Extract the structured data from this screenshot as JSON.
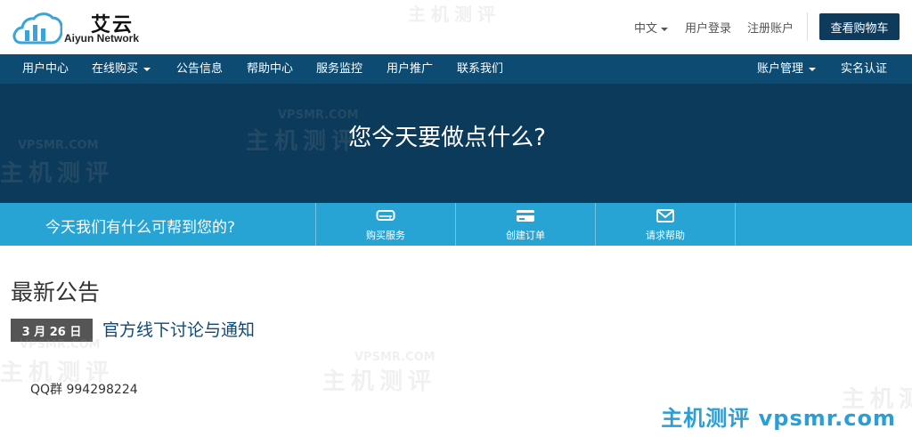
{
  "brand": {
    "name_cn": "艾云",
    "name_en": "Aiyun Network",
    "color_primary": "#0e3a5c",
    "color_nav": "#0d4b73",
    "color_hero": "#0b3a5a",
    "color_help": "#27a4d3",
    "logo_icon": "cloud-bars-logo"
  },
  "header": {
    "language": "中文",
    "login": "用户登录",
    "register": "注册账户",
    "cart_button": "查看购物车"
  },
  "nav": {
    "left": [
      {
        "label": "用户中心"
      },
      {
        "label": "在线购买",
        "dropdown": true
      },
      {
        "label": "公告信息"
      },
      {
        "label": "帮助中心"
      },
      {
        "label": "服务监控"
      },
      {
        "label": "用户推广"
      },
      {
        "label": "联系我们"
      }
    ],
    "right": [
      {
        "label": "账户管理",
        "dropdown": true
      },
      {
        "label": "实名认证"
      }
    ]
  },
  "hero": {
    "title": "您今天要做点什么?"
  },
  "help": {
    "text": "今天我们有什么可帮到您的?",
    "items": [
      {
        "label": "购买服务",
        "icon": "server-icon"
      },
      {
        "label": "创建订单",
        "icon": "credit-card-icon"
      },
      {
        "label": "请求帮助",
        "icon": "envelope-icon"
      }
    ]
  },
  "announcements": {
    "title": "最新公告",
    "items": [
      {
        "date": "3 月 26 日",
        "title": "官方线下讨论与通知",
        "body": "QQ群 994298224"
      }
    ]
  },
  "watermark": {
    "site_label": "主机测评 vpsmr.com",
    "text_cn": "主机测评",
    "text_en": "VPSMR.COM"
  }
}
